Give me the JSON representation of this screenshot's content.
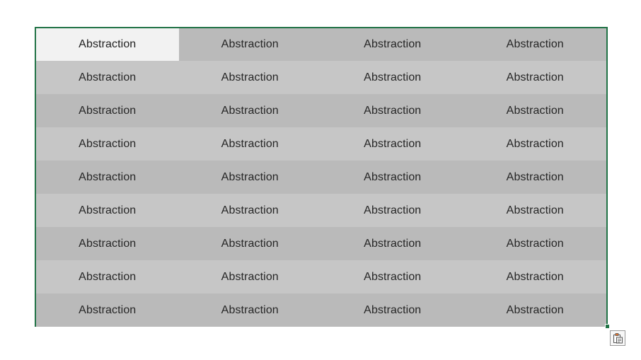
{
  "grid": {
    "rows": [
      [
        "Abstraction",
        "Abstraction",
        "Abstraction",
        "Abstraction"
      ],
      [
        "Abstraction",
        "Abstraction",
        "Abstraction",
        "Abstraction"
      ],
      [
        "Abstraction",
        "Abstraction",
        "Abstraction",
        "Abstraction"
      ],
      [
        "Abstraction",
        "Abstraction",
        "Abstraction",
        "Abstraction"
      ],
      [
        "Abstraction",
        "Abstraction",
        "Abstraction",
        "Abstraction"
      ],
      [
        "Abstraction",
        "Abstraction",
        "Abstraction",
        "Abstraction"
      ],
      [
        "Abstraction",
        "Abstraction",
        "Abstraction",
        "Abstraction"
      ],
      [
        "Abstraction",
        "Abstraction",
        "Abstraction",
        "Abstraction"
      ],
      [
        "Abstraction",
        "Abstraction",
        "Abstraction",
        "Abstraction"
      ]
    ]
  },
  "icons": {
    "paste_options": "paste-options-icon",
    "fill_handle": "fill-handle-icon"
  },
  "colors": {
    "selection_border": "#217346",
    "active_cell": "#f2f2f2",
    "row_dark": "#bababa",
    "row_light": "#c6c6c6",
    "paste_icon_accent": "#e8742c"
  }
}
